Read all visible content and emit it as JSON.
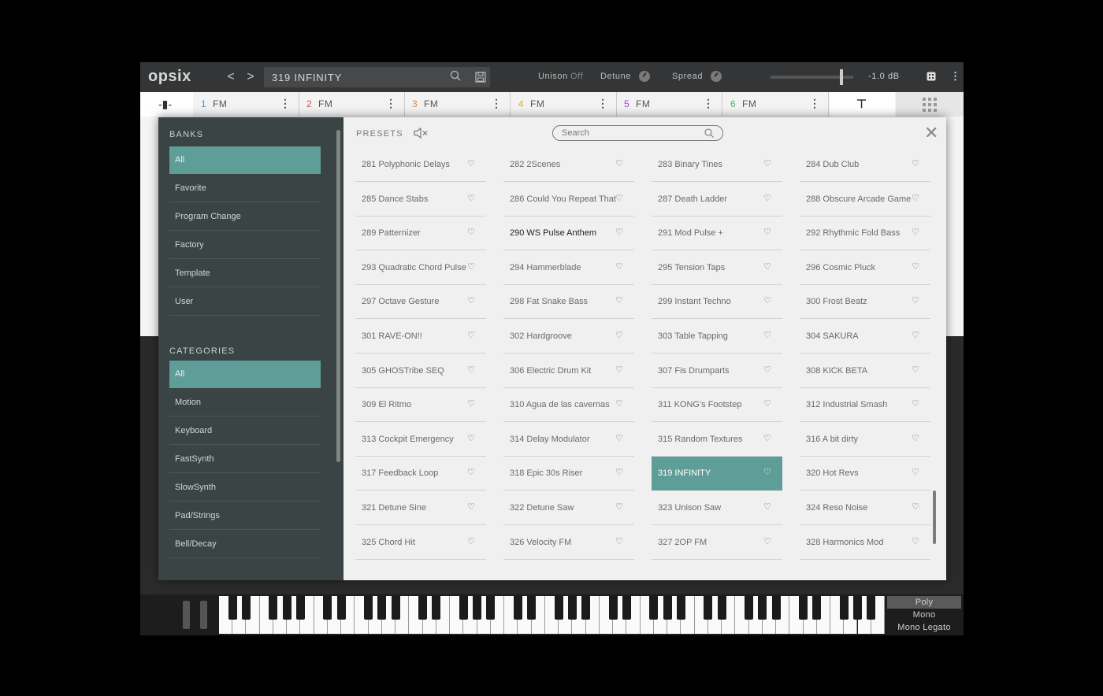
{
  "app": {
    "logo": "opsix"
  },
  "topbar": {
    "prev": "<",
    "next": ">",
    "preset_name": "319 INFINITY",
    "unison_label": "Unison",
    "unison_value": "Off",
    "detune_label": "Detune",
    "spread_label": "Spread",
    "volume": "-1.0 dB"
  },
  "operators": [
    {
      "num": "1",
      "name": "FM",
      "color": "#4a8fd6"
    },
    {
      "num": "2",
      "name": "FM",
      "color": "#d64a4a"
    },
    {
      "num": "3",
      "name": "FM",
      "color": "#e08a2a"
    },
    {
      "num": "4",
      "name": "FM",
      "color": "#d6b52a"
    },
    {
      "num": "5",
      "name": "FM",
      "color": "#9b4ad6"
    },
    {
      "num": "6",
      "name": "FM",
      "color": "#4ab86a"
    }
  ],
  "browser": {
    "banks_title": "BANKS",
    "banks": [
      "All",
      "Favorite",
      "Program Change",
      "Factory",
      "Template",
      "User"
    ],
    "categories_title": "CATEGORIES",
    "categories": [
      "All",
      "Motion",
      "Keyboard",
      "FastSynth",
      "SlowSynth",
      "Pad/Strings",
      "Bell/Decay"
    ],
    "presets_title": "PRESETS",
    "search_placeholder": "Search",
    "presets": [
      "281 Polyphonic Delays",
      "282 2Scenes",
      "283 Binary Tines",
      "284 Dub Club",
      "285 Dance Stabs",
      "286 Could You Repeat That",
      "287 Death Ladder",
      "288 Obscure Arcade Game",
      "289 Patternizer",
      "290 WS Pulse Anthem",
      "291 Mod Pulse +",
      "292 Rhythmic Fold Bass",
      "293 Quadratic Chord Pulse",
      "294 Hammerblade",
      "295 Tension Taps",
      "296 Cosmic Pluck",
      "297 Octave Gesture",
      "298 Fat Snake Bass",
      "299 Instant Techno",
      "300 Frost Beatz",
      "301 RAVE-ON!!",
      "302 Hardgroove",
      "303 Table Tapping",
      "304 SAKURA",
      "305 GHOSTribe SEQ",
      "306 Electric Drum Kit",
      "307 Fis Drumparts",
      "308 KICK BETA",
      "309 El Ritmo",
      "310 Agua de las cavernas",
      "311 KONG's Footstep",
      "312 Industrial Smash",
      "313 Cockpit Emergency",
      "314 Delay Modulator",
      "315 Random Textures",
      "316 A bit dirty",
      "317 Feedback Loop",
      "318 Epic 30s Riser",
      "319 INFINITY",
      "320 Hot Revs",
      "321 Detune Sine",
      "322 Detune Saw",
      "323 Unison Saw",
      "324 Reso Noise",
      "325 Chord Hit",
      "326 Velocity FM",
      "327 2OP FM",
      "328 Harmonics Mod"
    ],
    "selected_preset": "319 INFINITY",
    "hovered_preset": "290 WS Pulse Anthem"
  },
  "voice_modes": [
    "Poly",
    "Mono",
    "Mono Legato"
  ],
  "selected_voice_mode": "Poly",
  "colors": {
    "accent": "#5f9e98"
  }
}
